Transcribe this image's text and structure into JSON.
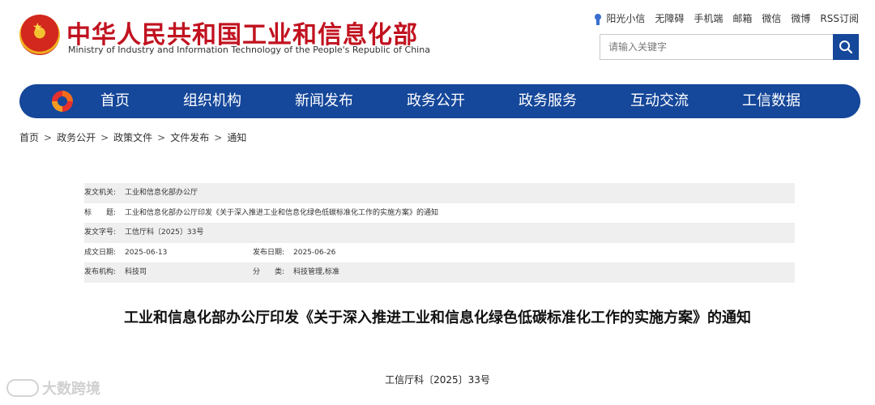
{
  "header": {
    "title_cn": "中华人民共和国工业和信息化部",
    "title_en": "Ministry of Industry and Information Technology of the People's Republic of China",
    "toplinks": [
      "阳光小信",
      "无障碍",
      "手机端",
      "邮箱",
      "微信",
      "微博",
      "RSS订阅"
    ],
    "search_placeholder": "请输入关键字"
  },
  "nav": {
    "items": [
      "首页",
      "组织机构",
      "新闻发布",
      "政务公开",
      "政务服务",
      "互动交流",
      "工信数据"
    ]
  },
  "breadcrumb": [
    "首页",
    "政务公开",
    "政策文件",
    "文件发布",
    "通知"
  ],
  "info": {
    "issuer_label": "发文机关:",
    "issuer": "工业和信息化部办公厅",
    "title_label": "标　　题:",
    "title": "工业和信息化部办公厅印发《关于深入推进工业和信息化绿色低碳标准化工作的实施方案》的通知",
    "docno_label": "发文字号:",
    "docno": "工信厅科〔2025〕33号",
    "created_label": "成文日期:",
    "created": "2025-06-13",
    "published_label": "发布日期:",
    "published": "2025-06-26",
    "org_label": "发布机构:",
    "org": "科技司",
    "category_label": "分　　类:",
    "category": "科技管理,标准"
  },
  "document": {
    "title": "工业和信息化部办公厅印发《关于深入推进工业和信息化绿色低碳标准化工作的实施方案》的通知",
    "number": "工信厅科〔2025〕33号"
  },
  "watermark": {
    "text": "大数跨境"
  },
  "colors": {
    "brand_red": "#c1121f",
    "nav_blue": "#15479a"
  }
}
